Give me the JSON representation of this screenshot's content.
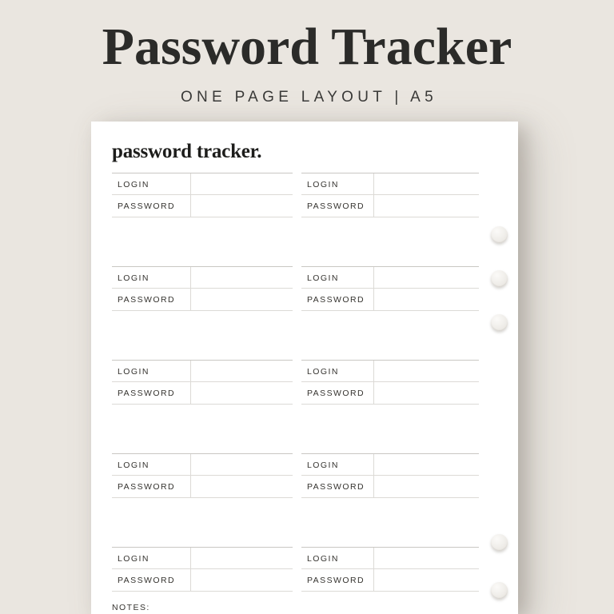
{
  "header": {
    "title": "Password Tracker",
    "subtitle": "ONE PAGE LAYOUT | A5"
  },
  "page": {
    "heading": "password tracker.",
    "notes_label": "NOTES:",
    "field_labels": {
      "login": "LOGIN",
      "password": "PASSWORD"
    },
    "entries": [
      {
        "login": "",
        "password": ""
      },
      {
        "login": "",
        "password": ""
      },
      {
        "login": "",
        "password": ""
      },
      {
        "login": "",
        "password": ""
      },
      {
        "login": "",
        "password": ""
      },
      {
        "login": "",
        "password": ""
      },
      {
        "login": "",
        "password": ""
      },
      {
        "login": "",
        "password": ""
      },
      {
        "login": "",
        "password": ""
      },
      {
        "login": "",
        "password": ""
      }
    ],
    "ring_holes": 5
  },
  "colors": {
    "background": "#eae6e0",
    "paper": "#ffffff",
    "ink": "#2b2b29",
    "rule": "#dcdad6"
  }
}
